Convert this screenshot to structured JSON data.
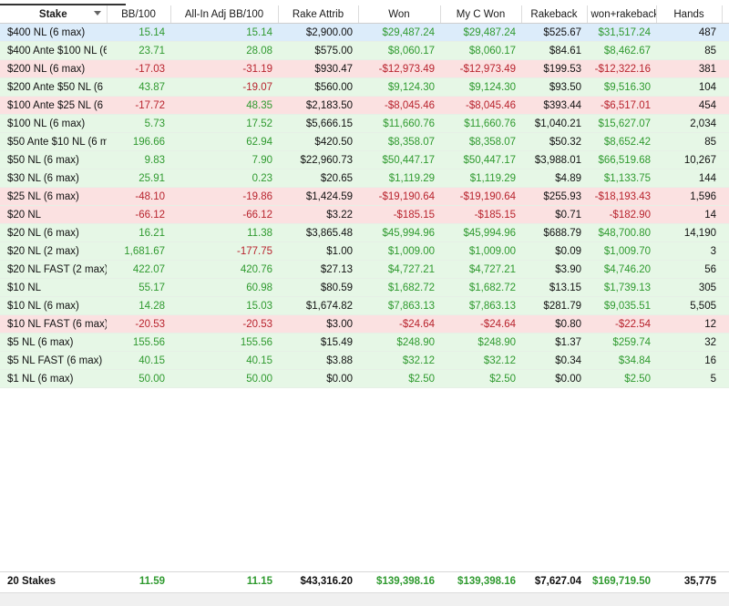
{
  "columns": [
    "Stake",
    "BB/100",
    "All-In Adj BB/100",
    "Rake Attrib",
    "Won",
    "My C Won",
    "Rakeback",
    "won+rakeback",
    "Hands"
  ],
  "rows": [
    {
      "stake": "$400 NL (6 max)",
      "bb100": "15.14",
      "allin": "15.14",
      "rake": "$2,900.00",
      "won": "$29,487.24",
      "mycwon": "$29,487.24",
      "rakeback": "$525.67",
      "wonrb": "$31,517.24",
      "hands": "487",
      "state": "sel",
      "sign": "pos"
    },
    {
      "stake": "$400 Ante $100 NL (6",
      "bb100": "23.71",
      "allin": "28.08",
      "rake": "$575.00",
      "won": "$8,060.17",
      "mycwon": "$8,060.17",
      "rakeback": "$84.61",
      "wonrb": "$8,462.67",
      "hands": "85",
      "state": "pos",
      "sign": "pos"
    },
    {
      "stake": "$200 NL (6 max)",
      "bb100": "-17.03",
      "allin": "-31.19",
      "rake": "$930.47",
      "won": "-$12,973.49",
      "mycwon": "-$12,973.49",
      "rakeback": "$199.53",
      "wonrb": "-$12,322.16",
      "hands": "381",
      "state": "neg",
      "sign": "neg"
    },
    {
      "stake": "$200 Ante $50 NL (6",
      "bb100": "43.87",
      "allin": "-19.07",
      "rake": "$560.00",
      "won": "$9,124.30",
      "mycwon": "$9,124.30",
      "rakeback": "$93.50",
      "wonrb": "$9,516.30",
      "hands": "104",
      "state": "pos",
      "sign": "pos",
      "allin_neg": true
    },
    {
      "stake": "$100 Ante $25 NL (6",
      "bb100": "-17.72",
      "allin": "48.35",
      "rake": "$2,183.50",
      "won": "-$8,045.46",
      "mycwon": "-$8,045.46",
      "rakeback": "$393.44",
      "wonrb": "-$6,517.01",
      "hands": "454",
      "state": "neg",
      "sign": "neg",
      "allin_pos": true
    },
    {
      "stake": "$100 NL (6 max)",
      "bb100": "5.73",
      "allin": "17.52",
      "rake": "$5,666.15",
      "won": "$11,660.76",
      "mycwon": "$11,660.76",
      "rakeback": "$1,040.21",
      "wonrb": "$15,627.07",
      "hands": "2,034",
      "state": "pos",
      "sign": "pos"
    },
    {
      "stake": "$50 Ante $10 NL (6 m",
      "bb100": "196.66",
      "allin": "62.94",
      "rake": "$420.50",
      "won": "$8,358.07",
      "mycwon": "$8,358.07",
      "rakeback": "$50.32",
      "wonrb": "$8,652.42",
      "hands": "85",
      "state": "pos",
      "sign": "pos"
    },
    {
      "stake": "$50 NL (6 max)",
      "bb100": "9.83",
      "allin": "7.90",
      "rake": "$22,960.73",
      "won": "$50,447.17",
      "mycwon": "$50,447.17",
      "rakeback": "$3,988.01",
      "wonrb": "$66,519.68",
      "hands": "10,267",
      "state": "pos",
      "sign": "pos"
    },
    {
      "stake": "$30 NL (6 max)",
      "bb100": "25.91",
      "allin": "0.23",
      "rake": "$20.65",
      "won": "$1,119.29",
      "mycwon": "$1,119.29",
      "rakeback": "$4.89",
      "wonrb": "$1,133.75",
      "hands": "144",
      "state": "pos",
      "sign": "pos"
    },
    {
      "stake": "$25 NL (6 max)",
      "bb100": "-48.10",
      "allin": "-19.86",
      "rake": "$1,424.59",
      "won": "-$19,190.64",
      "mycwon": "-$19,190.64",
      "rakeback": "$255.93",
      "wonrb": "-$18,193.43",
      "hands": "1,596",
      "state": "neg",
      "sign": "neg"
    },
    {
      "stake": "$20 NL",
      "bb100": "-66.12",
      "allin": "-66.12",
      "rake": "$3.22",
      "won": "-$185.15",
      "mycwon": "-$185.15",
      "rakeback": "$0.71",
      "wonrb": "-$182.90",
      "hands": "14",
      "state": "neg",
      "sign": "neg"
    },
    {
      "stake": "$20 NL (6 max)",
      "bb100": "16.21",
      "allin": "11.38",
      "rake": "$3,865.48",
      "won": "$45,994.96",
      "mycwon": "$45,994.96",
      "rakeback": "$688.79",
      "wonrb": "$48,700.80",
      "hands": "14,190",
      "state": "pos",
      "sign": "pos"
    },
    {
      "stake": "$20 NL (2 max)",
      "bb100": "1,681.67",
      "allin": "-177.75",
      "rake": "$1.00",
      "won": "$1,009.00",
      "mycwon": "$1,009.00",
      "rakeback": "$0.09",
      "wonrb": "$1,009.70",
      "hands": "3",
      "state": "pos",
      "sign": "pos",
      "allin_neg": true
    },
    {
      "stake": "$20 NL FAST (2 max)",
      "bb100": "422.07",
      "allin": "420.76",
      "rake": "$27.13",
      "won": "$4,727.21",
      "mycwon": "$4,727.21",
      "rakeback": "$3.90",
      "wonrb": "$4,746.20",
      "hands": "56",
      "state": "pos",
      "sign": "pos"
    },
    {
      "stake": "$10 NL",
      "bb100": "55.17",
      "allin": "60.98",
      "rake": "$80.59",
      "won": "$1,682.72",
      "mycwon": "$1,682.72",
      "rakeback": "$13.15",
      "wonrb": "$1,739.13",
      "hands": "305",
      "state": "pos",
      "sign": "pos"
    },
    {
      "stake": "$10 NL (6 max)",
      "bb100": "14.28",
      "allin": "15.03",
      "rake": "$1,674.82",
      "won": "$7,863.13",
      "mycwon": "$7,863.13",
      "rakeback": "$281.79",
      "wonrb": "$9,035.51",
      "hands": "5,505",
      "state": "pos",
      "sign": "pos"
    },
    {
      "stake": "$10 NL FAST (6 max)",
      "bb100": "-20.53",
      "allin": "-20.53",
      "rake": "$3.00",
      "won": "-$24.64",
      "mycwon": "-$24.64",
      "rakeback": "$0.80",
      "wonrb": "-$22.54",
      "hands": "12",
      "state": "neg",
      "sign": "neg"
    },
    {
      "stake": "$5 NL (6 max)",
      "bb100": "155.56",
      "allin": "155.56",
      "rake": "$15.49",
      "won": "$248.90",
      "mycwon": "$248.90",
      "rakeback": "$1.37",
      "wonrb": "$259.74",
      "hands": "32",
      "state": "pos",
      "sign": "pos"
    },
    {
      "stake": "$5 NL FAST (6 max)",
      "bb100": "40.15",
      "allin": "40.15",
      "rake": "$3.88",
      "won": "$32.12",
      "mycwon": "$32.12",
      "rakeback": "$0.34",
      "wonrb": "$34.84",
      "hands": "16",
      "state": "pos",
      "sign": "pos"
    },
    {
      "stake": "$1 NL (6 max)",
      "bb100": "50.00",
      "allin": "50.00",
      "rake": "$0.00",
      "won": "$2.50",
      "mycwon": "$2.50",
      "rakeback": "$0.00",
      "wonrb": "$2.50",
      "hands": "5",
      "state": "pos",
      "sign": "pos"
    }
  ],
  "footer": {
    "stake": "20 Stakes",
    "bb100": "11.59",
    "allin": "11.15",
    "rake": "$43,316.20",
    "won": "$139,398.16",
    "mycwon": "$139,398.16",
    "rakeback": "$7,627.04",
    "wonrb": "$169,719.50",
    "hands": "35,775"
  },
  "colors": {
    "positive_text": "#2f9a2f",
    "negative_text": "#b8232d",
    "positive_row": "#e6f7e6",
    "negative_row": "#fbe1e1",
    "selected_row": "#dcecfa"
  },
  "icons": {
    "sort": "sort-desc-arrow-icon"
  }
}
